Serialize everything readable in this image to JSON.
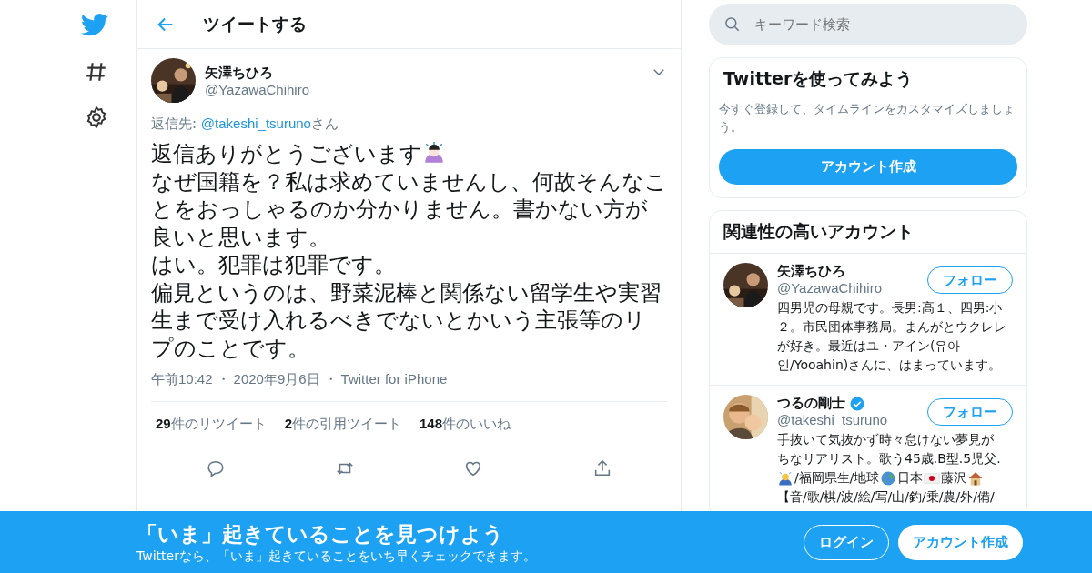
{
  "header": {
    "title": "ツイートする"
  },
  "tweet": {
    "name": "矢澤ちひろ",
    "handle": "@YazawaChihiro",
    "reply_prefix": "返信先: ",
    "reply_to": "@takeshi_tsuruno",
    "reply_suffix": "さん",
    "lines": [
      {
        "text": "返信ありがとうございます",
        "kind": "with-emoji"
      },
      {
        "text": "なぜ国籍を？私は求めていませんし、何故そんなことをおっしゃるのか分かりません。書かない方が良いと思います。",
        "kind": "plain"
      },
      {
        "text": "はい。犯罪は犯罪です。",
        "kind": "plain"
      },
      {
        "text": "偏見というのは、野菜泥棒と関係ない留学生や実習生まで受け入れるべきでないとかいう主張等のリプのことです。",
        "kind": "plain"
      }
    ],
    "time": "午前10:42",
    "separator": "・",
    "date": "2020年9月6日",
    "source": "Twitter for iPhone",
    "stats": [
      {
        "count": "29",
        "label": "件のリツイート"
      },
      {
        "count": "2",
        "label": "件の引用ツイート"
      },
      {
        "count": "148",
        "label": "件のいいね"
      }
    ],
    "actions": [
      {
        "kind": "reply"
      },
      {
        "kind": "retweet"
      },
      {
        "kind": "like"
      },
      {
        "kind": "share"
      }
    ]
  },
  "search": {
    "placeholder": "キーワード検索"
  },
  "signup": {
    "title": "Twitterを使ってみよう",
    "text": "今すぐ登録して、タイムラインをカスタマイズしましょう。",
    "button": "アカウント作成"
  },
  "related": {
    "title": "関連性の高いアカウント",
    "accounts": [
      {
        "name": "矢澤ちひろ",
        "verified": false,
        "handle": "@YazawaChihiro",
        "follow": "フォロー",
        "bio": [
          [
            {
              "kind": "text",
              "text": "四男児の母親です。長男:高１、四男:小２。市民団体事務局。まんがとウクレレが好き。最近はユ・アイン(유아인/Yooahin)さんに、はまっています。"
            }
          ]
        ]
      },
      {
        "name": "つるの剛士",
        "verified": true,
        "handle": "@takeshi_tsuruno",
        "follow": "フォロー",
        "bio": [
          [
            {
              "kind": "text",
              "text": "手抜いて気抜かず時々怠けない夢見が"
            }
          ],
          [
            {
              "kind": "text",
              "text": "ちなリアリスト。歌う45歳.B型.5児父."
            }
          ],
          [
            {
              "kind": "person"
            },
            {
              "kind": "text",
              "text": "/福岡県生/地球"
            },
            {
              "kind": "globe"
            },
            {
              "kind": "text",
              "text": "日本"
            },
            {
              "kind": "flag"
            },
            {
              "kind": "text",
              "text": "藤沢"
            },
            {
              "kind": "house"
            }
          ],
          [
            {
              "kind": "text",
              "text": "【音/歌/棋/波/絵/写/山/釣/乗/農/外/備/"
            }
          ]
        ]
      }
    ]
  },
  "banner": {
    "title": "「いま」起きていることを見つけよう",
    "text": "Twitterなら、「いま」起きていることをいち早くチェックできます。",
    "login": "ログイン",
    "signup": "アカウント作成"
  }
}
